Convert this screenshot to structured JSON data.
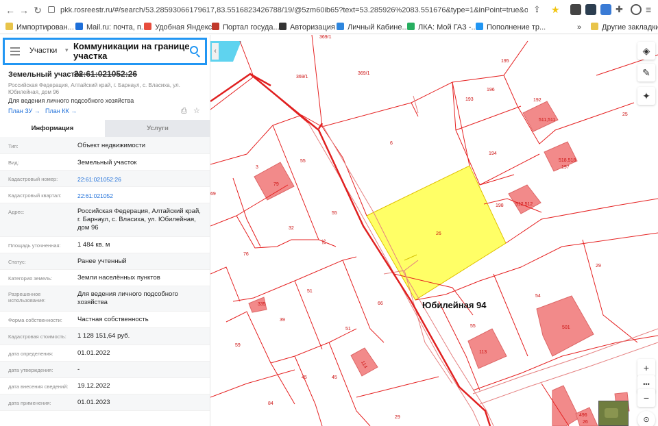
{
  "browser": {
    "url": "pkk.rosreestr.ru/#/search/53.28593066179617,83.5516823426788/19/@5zm60ib65?text=53.285926%2083.551676&type=1&inPoint=true&opened=22%...",
    "bookmarks": [
      {
        "label": "Импортирован...",
        "color": "#e8c44a"
      },
      {
        "label": "Mail.ru: почта, п...",
        "color": "#1e6fd9"
      },
      {
        "label": "Удобная Яндекс...",
        "color": "#e74c3c"
      },
      {
        "label": "Портал госуда...",
        "color": "#c0392b"
      },
      {
        "label": "Авторизация",
        "color": "#333333"
      },
      {
        "label": "Личный Кабине...",
        "color": "#2e86de"
      },
      {
        "label": "ЛКА: Мой ГАЗ -...",
        "color": "#27ae60"
      },
      {
        "label": "Пополнение тр...",
        "color": "#2196f3"
      }
    ],
    "other_bookmarks": "Другие закладки"
  },
  "search": {
    "type": "Участки",
    "overlay_text": "Коммуникации на границе участка",
    "strike_text": "22:61:021052:26"
  },
  "object": {
    "title": "Земельный участок",
    "number": "22:61:021052:26",
    "address": "Российская Федерация, Алтайский край, г. Барнаул, с. Власиха, ул. Юбилейная, дом 96",
    "use": "Для ведения личного подсобного хозяйства",
    "plan_zu": "План ЗУ →",
    "plan_kk": "План КК →"
  },
  "tabs": {
    "info": "Информация",
    "services": "Услуги"
  },
  "rows": [
    {
      "key": "Тип:",
      "value": "Объект недвижимости",
      "link": false
    },
    {
      "key": "Вид:",
      "value": "Земельный участок",
      "link": false
    },
    {
      "key": "Кадастровый номер:",
      "value": "22:61:021052:26",
      "link": true
    },
    {
      "key": "Кадастровый квартал:",
      "value": "22:61:021052",
      "link": true
    },
    {
      "key": "Адрес:",
      "value": "Российская Федерация, Алтайский край, г. Барнаул, с. Власиха, ул. Юбилейная, дом 96",
      "link": false
    },
    {
      "key": "Площадь уточненная:",
      "value": "1 484 кв. м",
      "link": false
    },
    {
      "key": "Статус:",
      "value": "Ранее учтенный",
      "link": false
    },
    {
      "key": "Категория земель:",
      "value": "Земли населённых пунктов",
      "link": false
    },
    {
      "key": "Разрешенное использование:",
      "value": "Для ведения личного подсобного хозяйства",
      "link": false
    },
    {
      "key": "Форма собственности:",
      "value": "Частная собственность",
      "link": false
    },
    {
      "key": "Кадастровая стоимость:",
      "value": "1 128 151,64 руб.",
      "link": false
    },
    {
      "key": "дата определения:",
      "value": "01.01.2022",
      "link": false
    },
    {
      "key": "дата утверждения:",
      "value": "-",
      "link": false
    },
    {
      "key": "дата внесения сведений:",
      "value": "19.12.2022",
      "link": false
    },
    {
      "key": "дата применения:",
      "value": "01.01.2023",
      "link": false
    }
  ],
  "map": {
    "annotation": "Юбилейная 94",
    "labels": [
      "369/1",
      "369/1",
      "195",
      "196",
      "193",
      "192",
      "511,511",
      "25",
      "6",
      "194",
      "518,518",
      "197",
      "3",
      "79",
      "55",
      "69",
      "198",
      "512,512",
      "32",
      "55",
      "26",
      "76",
      "32",
      "29",
      "51",
      "66",
      "54",
      "335",
      "39",
      "51",
      "55",
      "501",
      "59",
      "113",
      "114",
      "45",
      "45",
      "84",
      "29",
      "496",
      "26"
    ],
    "controls": {
      "layers": "layers-icon",
      "ruler": "ruler-icon",
      "locate": "locate-icon",
      "zoom_in": "+",
      "more": "•••",
      "zoom_out": "−"
    }
  }
}
